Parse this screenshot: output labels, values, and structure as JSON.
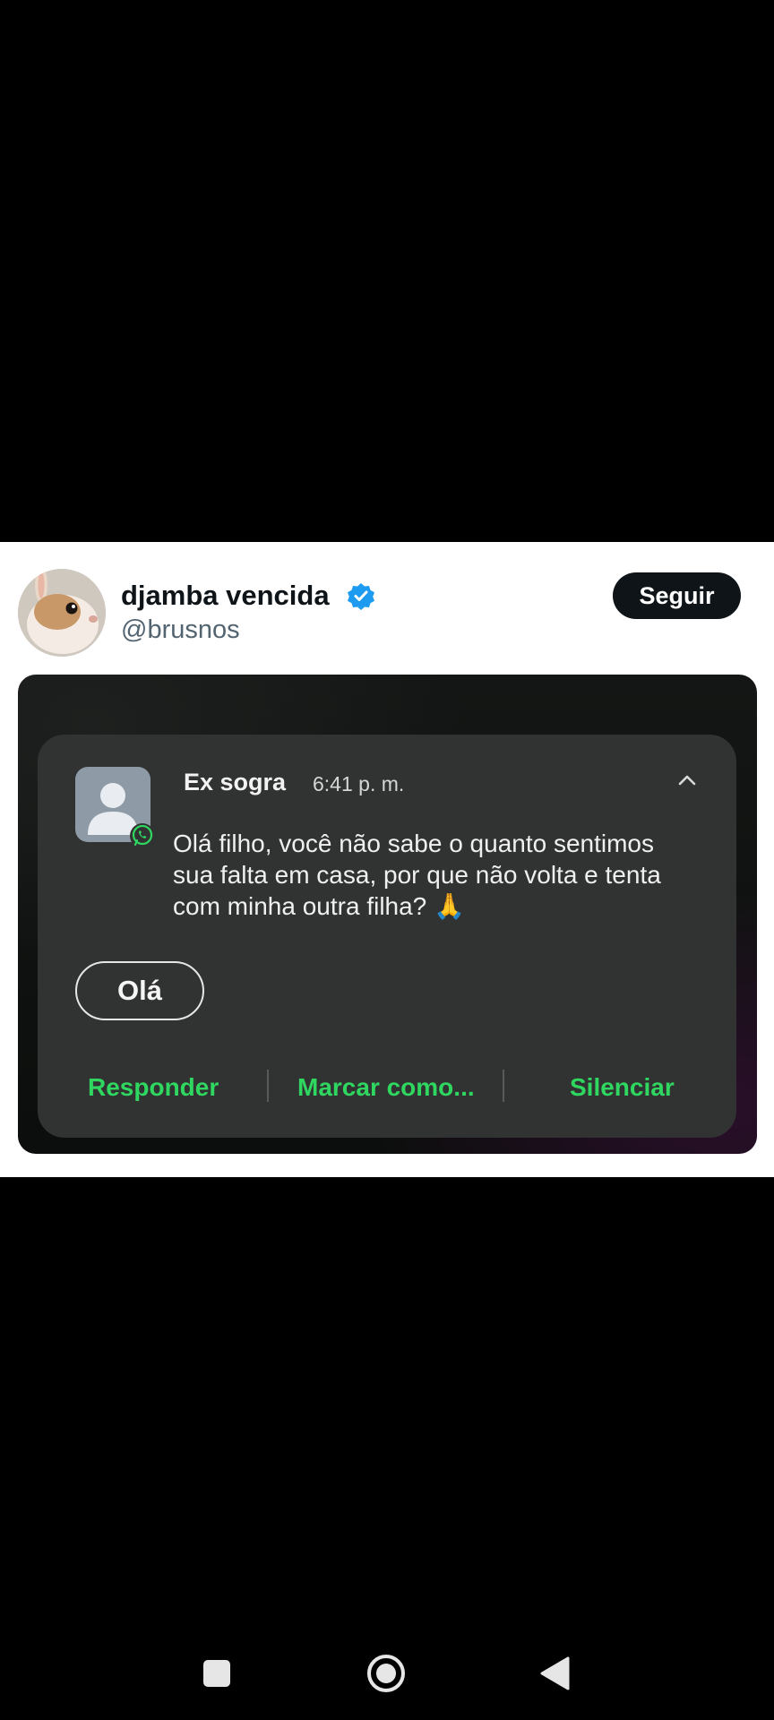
{
  "tweet": {
    "display_name": "djamba vencida",
    "handle": "@brusnos",
    "follow_label": "Seguir",
    "verified_icon": "verified-badge-icon"
  },
  "notification": {
    "sender": "Ex sogra",
    "time": "6:41 p. m.",
    "message": "Olá filho, você não sabe o quanto sentimos sua falta em casa, por que não volta e tenta com minha outra filha? 🙏",
    "quick_reply": "Olá",
    "actions": [
      "Responder",
      "Marcar como...",
      "Silenciar"
    ],
    "accent_color": "#2fd65f"
  },
  "navbar": {
    "icons": [
      "square-recents-icon",
      "circle-home-icon",
      "triangle-back-icon"
    ]
  }
}
